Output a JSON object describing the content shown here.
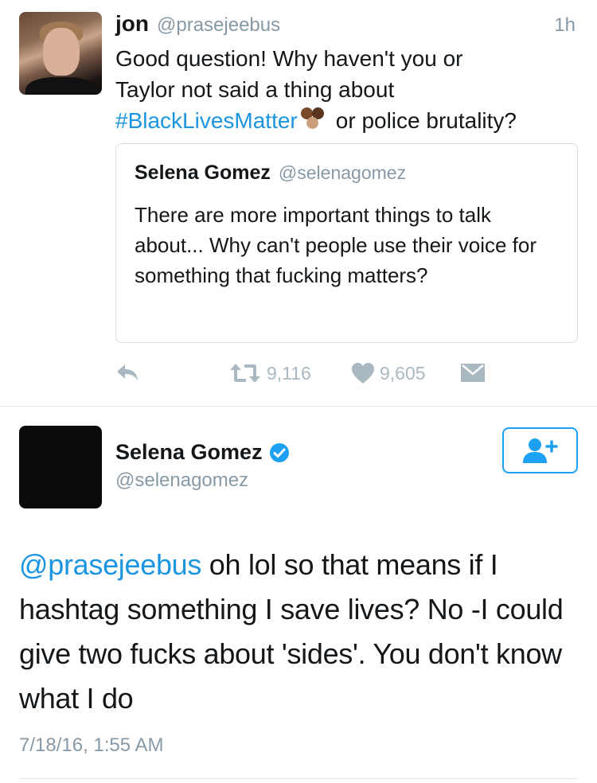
{
  "tweet": {
    "author_name": "jon",
    "author_handle": "@prasejeebus",
    "time": "1h",
    "text_line1": "Good question! Why haven't you or",
    "text_line2": "Taylor not said a thing about",
    "hashtag": "#BlackLivesMatter",
    "emoji": "raised-fists-emoji",
    "text_line3_rest": "or police brutality?",
    "quoted": {
      "author_name": "Selena Gomez",
      "author_handle": "@selenagomez",
      "text": "There are more important things to talk about... Why can't people use their voice for something that fucking matters?"
    },
    "actions": {
      "reply_icon": "reply-icon",
      "retweet_icon": "retweet-icon",
      "retweet_count": "9,116",
      "like_icon": "heart-icon",
      "like_count": "9,605",
      "dm_icon": "envelope-icon"
    }
  },
  "reply_tweet": {
    "author_name": "Selena Gomez",
    "verified_icon": "verified-badge-icon",
    "author_handle": "@selenagomez",
    "follow_icon": "follow-user-icon",
    "mention": "@prasejeebus",
    "text": " oh lol so that means if I hashtag something I save lives? No -I could give two fucks about 'sides'. You don't know what I do",
    "timestamp": "7/18/16, 1:55 AM"
  },
  "colors": {
    "link": "#1b95e0",
    "muted": "#8899a6",
    "icon": "#aab8c2",
    "verified": "#1da1f2"
  }
}
